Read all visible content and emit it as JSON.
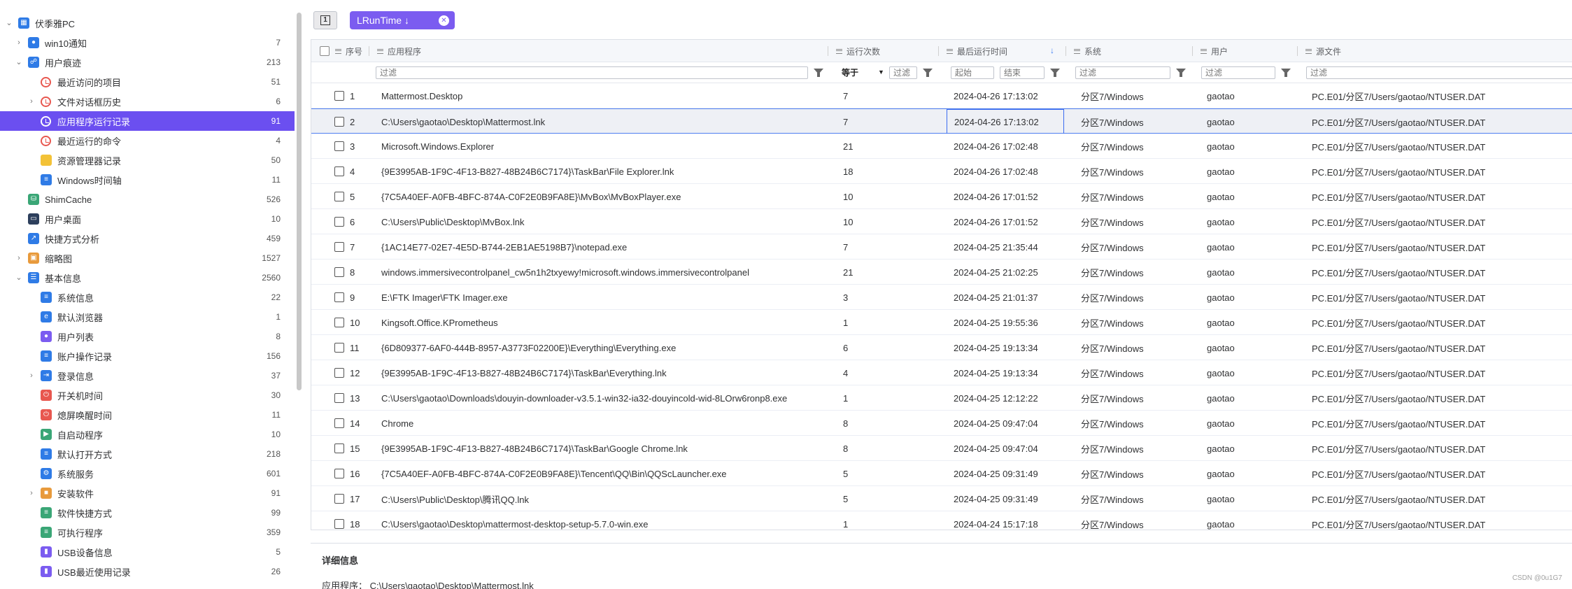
{
  "sidebar": {
    "items": [
      {
        "label": "伏季雅PC",
        "count": "",
        "icon": "windows-icon",
        "color": "#2f7be6",
        "level": 0,
        "expanded": true
      },
      {
        "label": "win10通知",
        "count": "7",
        "icon": "bell-icon",
        "color": "#2f7be6",
        "level": 1,
        "expanded": false
      },
      {
        "label": "用户痕迹",
        "count": "213",
        "icon": "footprint-icon",
        "color": "#2f7be6",
        "level": 1,
        "expanded": true
      },
      {
        "label": "最近访问的项目",
        "count": "51",
        "icon": "clock-icon",
        "color": "#e8574f",
        "level": 2,
        "expanded": null
      },
      {
        "label": "文件对话框历史",
        "count": "6",
        "icon": "clock-icon",
        "color": "#e8574f",
        "level": 2,
        "expanded": false
      },
      {
        "label": "应用程序运行记录",
        "count": "91",
        "icon": "clock-icon",
        "color": "#e8574f",
        "level": 2,
        "expanded": null,
        "selected": true
      },
      {
        "label": "最近运行的命令",
        "count": "4",
        "icon": "clock-icon",
        "color": "#e8574f",
        "level": 2,
        "expanded": null
      },
      {
        "label": "资源管理器记录",
        "count": "50",
        "icon": "folder-icon",
        "color": "#f3c237",
        "level": 2,
        "expanded": null
      },
      {
        "label": "Windows时间轴",
        "count": "11",
        "icon": "timeline-icon",
        "color": "#2f7be6",
        "level": 2,
        "expanded": null
      },
      {
        "label": "ShimCache",
        "count": "526",
        "icon": "cache-icon",
        "color": "#3aa676",
        "level": 1,
        "expanded": null
      },
      {
        "label": "用户桌面",
        "count": "10",
        "icon": "monitor-icon",
        "color": "#2d3f5c",
        "level": 1,
        "expanded": null
      },
      {
        "label": "快捷方式分析",
        "count": "459",
        "icon": "shortcut-icon",
        "color": "#2f7be6",
        "level": 1,
        "expanded": null
      },
      {
        "label": "缩略图",
        "count": "1527",
        "icon": "thumbnail-icon",
        "color": "#e89a3c",
        "level": 1,
        "expanded": false
      },
      {
        "label": "基本信息",
        "count": "2560",
        "icon": "document-icon",
        "color": "#2f7be6",
        "level": 1,
        "expanded": true
      },
      {
        "label": "系统信息",
        "count": "22",
        "icon": "list-icon",
        "color": "#2f7be6",
        "level": 2,
        "expanded": null
      },
      {
        "label": "默认浏览器",
        "count": "1",
        "icon": "browser-icon",
        "color": "#2f7be6",
        "level": 2,
        "expanded": null
      },
      {
        "label": "用户列表",
        "count": "8",
        "icon": "user-icon",
        "color": "#7b5cf0",
        "level": 2,
        "expanded": null
      },
      {
        "label": "账户操作记录",
        "count": "156",
        "icon": "account-icon",
        "color": "#2f7be6",
        "level": 2,
        "expanded": null
      },
      {
        "label": "登录信息",
        "count": "37",
        "icon": "login-icon",
        "color": "#2f7be6",
        "level": 2,
        "expanded": false
      },
      {
        "label": "开关机时间",
        "count": "30",
        "icon": "power-icon",
        "color": "#e8574f",
        "level": 2,
        "expanded": null
      },
      {
        "label": "熄屏唤醒时间",
        "count": "11",
        "icon": "power-icon",
        "color": "#e8574f",
        "level": 2,
        "expanded": null
      },
      {
        "label": "自启动程序",
        "count": "10",
        "icon": "play-icon",
        "color": "#3aa676",
        "level": 2,
        "expanded": null
      },
      {
        "label": "默认打开方式",
        "count": "218",
        "icon": "default-open-icon",
        "color": "#2f7be6",
        "level": 2,
        "expanded": null
      },
      {
        "label": "系统服务",
        "count": "601",
        "icon": "service-icon",
        "color": "#2f7be6",
        "level": 2,
        "expanded": null
      },
      {
        "label": "安装软件",
        "count": "91",
        "icon": "package-icon",
        "color": "#e89a3c",
        "level": 2,
        "expanded": false
      },
      {
        "label": "软件快捷方式",
        "count": "99",
        "icon": "app-list-icon",
        "color": "#3aa676",
        "level": 2,
        "expanded": null
      },
      {
        "label": "可执行程序",
        "count": "359",
        "icon": "app-list-icon",
        "color": "#3aa676",
        "level": 2,
        "expanded": null
      },
      {
        "label": "USB设备信息",
        "count": "5",
        "icon": "usb-icon",
        "color": "#7b5cf0",
        "level": 2,
        "expanded": null
      },
      {
        "label": "USB最近使用记录",
        "count": "26",
        "icon": "usb-icon",
        "color": "#7b5cf0",
        "level": 2,
        "expanded": null
      }
    ]
  },
  "toolbar": {
    "group_icon": "group-panel-icon",
    "chip_label": "LRunTime ↓",
    "chip_close_icon": "close-circle-icon"
  },
  "grid": {
    "columns": [
      "序号",
      "应用程序",
      "运行次数",
      "最后运行时间",
      "系统",
      "用户",
      "源文件"
    ],
    "filter": {
      "placeholder": "过滤",
      "count_op": "等于",
      "start": "起始",
      "end": "结束"
    },
    "rows": [
      [
        "1",
        "Mattermost.Desktop",
        "7",
        "2024-04-26 17:13:02",
        "分区7/Windows",
        "gaotao",
        "PC.E01/分区7/Users/gaotao/NTUSER.DAT"
      ],
      [
        "2",
        "C:\\Users\\gaotao\\Desktop\\Mattermost.lnk",
        "7",
        "2024-04-26 17:13:02",
        "分区7/Windows",
        "gaotao",
        "PC.E01/分区7/Users/gaotao/NTUSER.DAT"
      ],
      [
        "3",
        "Microsoft.Windows.Explorer",
        "21",
        "2024-04-26 17:02:48",
        "分区7/Windows",
        "gaotao",
        "PC.E01/分区7/Users/gaotao/NTUSER.DAT"
      ],
      [
        "4",
        "{9E3995AB-1F9C-4F13-B827-48B24B6C7174}\\TaskBar\\File Explorer.lnk",
        "18",
        "2024-04-26 17:02:48",
        "分区7/Windows",
        "gaotao",
        "PC.E01/分区7/Users/gaotao/NTUSER.DAT"
      ],
      [
        "5",
        "{7C5A40EF-A0FB-4BFC-874A-C0F2E0B9FA8E}\\MvBox\\MvBoxPlayer.exe",
        "10",
        "2024-04-26 17:01:52",
        "分区7/Windows",
        "gaotao",
        "PC.E01/分区7/Users/gaotao/NTUSER.DAT"
      ],
      [
        "6",
        "C:\\Users\\Public\\Desktop\\MvBox.lnk",
        "10",
        "2024-04-26 17:01:52",
        "分区7/Windows",
        "gaotao",
        "PC.E01/分区7/Users/gaotao/NTUSER.DAT"
      ],
      [
        "7",
        "{1AC14E77-02E7-4E5D-B744-2EB1AE5198B7}\\notepad.exe",
        "7",
        "2024-04-25 21:35:44",
        "分区7/Windows",
        "gaotao",
        "PC.E01/分区7/Users/gaotao/NTUSER.DAT"
      ],
      [
        "8",
        "windows.immersivecontrolpanel_cw5n1h2txyewy!microsoft.windows.immersivecontrolpanel",
        "21",
        "2024-04-25 21:02:25",
        "分区7/Windows",
        "gaotao",
        "PC.E01/分区7/Users/gaotao/NTUSER.DAT"
      ],
      [
        "9",
        "E:\\FTK Imager\\FTK Imager.exe",
        "3",
        "2024-04-25 21:01:37",
        "分区7/Windows",
        "gaotao",
        "PC.E01/分区7/Users/gaotao/NTUSER.DAT"
      ],
      [
        "10",
        "Kingsoft.Office.KPrometheus",
        "1",
        "2024-04-25 19:55:36",
        "分区7/Windows",
        "gaotao",
        "PC.E01/分区7/Users/gaotao/NTUSER.DAT"
      ],
      [
        "11",
        "{6D809377-6AF0-444B-8957-A3773F02200E}\\Everything\\Everything.exe",
        "6",
        "2024-04-25 19:13:34",
        "分区7/Windows",
        "gaotao",
        "PC.E01/分区7/Users/gaotao/NTUSER.DAT"
      ],
      [
        "12",
        "{9E3995AB-1F9C-4F13-B827-48B24B6C7174}\\TaskBar\\Everything.lnk",
        "4",
        "2024-04-25 19:13:34",
        "分区7/Windows",
        "gaotao",
        "PC.E01/分区7/Users/gaotao/NTUSER.DAT"
      ],
      [
        "13",
        "C:\\Users\\gaotao\\Downloads\\douyin-downloader-v3.5.1-win32-ia32-douyincold-wid-8LOrw6ronp8.exe",
        "1",
        "2024-04-25 12:12:22",
        "分区7/Windows",
        "gaotao",
        "PC.E01/分区7/Users/gaotao/NTUSER.DAT"
      ],
      [
        "14",
        "Chrome",
        "8",
        "2024-04-25 09:47:04",
        "分区7/Windows",
        "gaotao",
        "PC.E01/分区7/Users/gaotao/NTUSER.DAT"
      ],
      [
        "15",
        "{9E3995AB-1F9C-4F13-B827-48B24B6C7174}\\TaskBar\\Google Chrome.lnk",
        "8",
        "2024-04-25 09:47:04",
        "分区7/Windows",
        "gaotao",
        "PC.E01/分区7/Users/gaotao/NTUSER.DAT"
      ],
      [
        "16",
        "{7C5A40EF-A0FB-4BFC-874A-C0F2E0B9FA8E}\\Tencent\\QQ\\Bin\\QQScLauncher.exe",
        "5",
        "2024-04-25 09:31:49",
        "分区7/Windows",
        "gaotao",
        "PC.E01/分区7/Users/gaotao/NTUSER.DAT"
      ],
      [
        "17",
        "C:\\Users\\Public\\Desktop\\腾讯QQ.lnk",
        "5",
        "2024-04-25 09:31:49",
        "分区7/Windows",
        "gaotao",
        "PC.E01/分区7/Users/gaotao/NTUSER.DAT"
      ],
      [
        "18",
        "C:\\Users\\gaotao\\Desktop\\mattermost-desktop-setup-5.7.0-win.exe",
        "1",
        "2024-04-24 15:17:18",
        "分区7/Windows",
        "gaotao",
        "PC.E01/分区7/Users/gaotao/NTUSER.DAT"
      ]
    ],
    "selected_row": 1
  },
  "detail": {
    "title": "详细信息",
    "app_label": "应用程序：",
    "app_value": "C:\\Users\\gaotao\\Desktop\\Mattermost.lnk"
  },
  "watermark": "CSDN @0u1G7",
  "colors": {
    "accent": "#6b4ff0",
    "chip": "#7b5cf0",
    "focus_border": "#3b6cf0"
  }
}
